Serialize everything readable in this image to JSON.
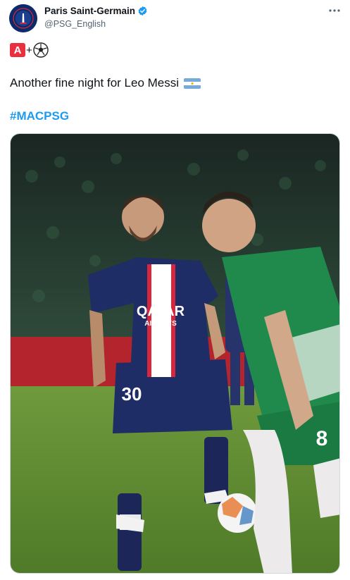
{
  "account": {
    "display_name": "Paris Saint-Germain",
    "handle": "@PSG_English",
    "avatar_text": "PARIS",
    "verified_icon": "verified-badge-icon",
    "more_icon": "more-options-icon"
  },
  "tweet": {
    "emoji_line": {
      "letter": "A",
      "plus": "+",
      "ball_icon": "soccer-ball-icon"
    },
    "text": "Another fine night for Leo Messi",
    "flag_icon": "argentina-flag-icon",
    "hashtag": "#MACPSG"
  },
  "media": {
    "jersey_sponsor": "QATAR",
    "jersey_sponsor_sub": "AIRWAYS",
    "shorts_number": "30",
    "opponent_number": "8"
  },
  "colors": {
    "link_blue": "#1d9bf0",
    "secondary_text": "#536471",
    "psg_navy": "#1f2d66",
    "haifa_green": "#1f8a4c"
  }
}
